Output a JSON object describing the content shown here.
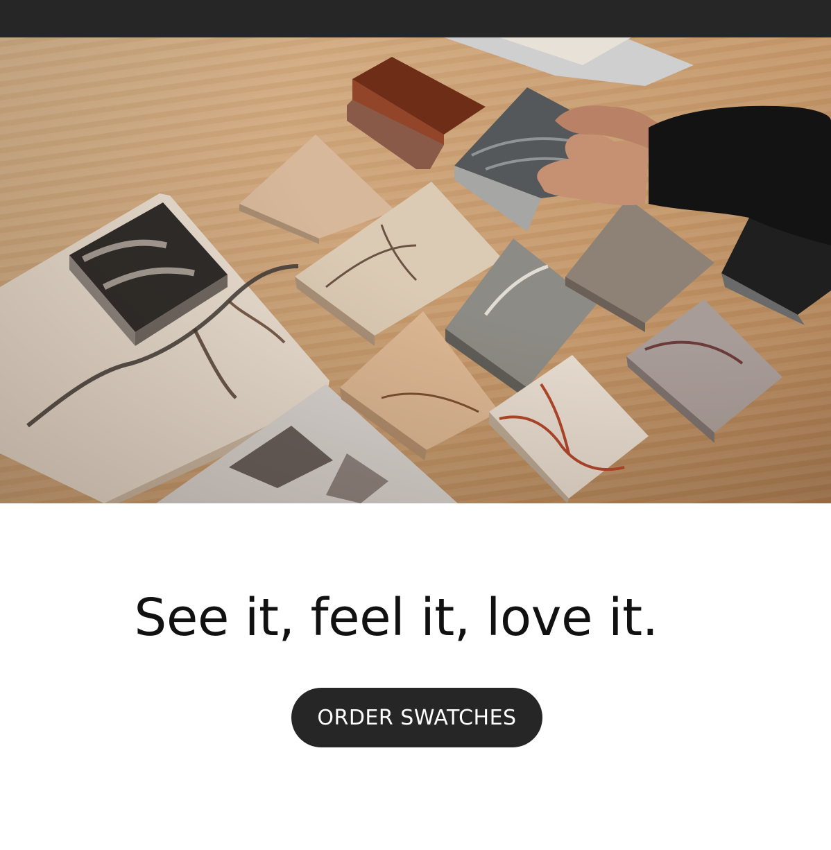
{
  "hero": {
    "image_alt": "Assorted marble and stone swatches laid out on a travertine table, with a hand picking up a grey veined sample",
    "colors": {
      "background": "#ffffff",
      "top_bar": "#262626",
      "button_bg": "#262626",
      "button_text": "#ffffff"
    }
  },
  "content": {
    "headline": "See it, feel it, love it.",
    "cta_label": "ORDER SWATCHES"
  }
}
